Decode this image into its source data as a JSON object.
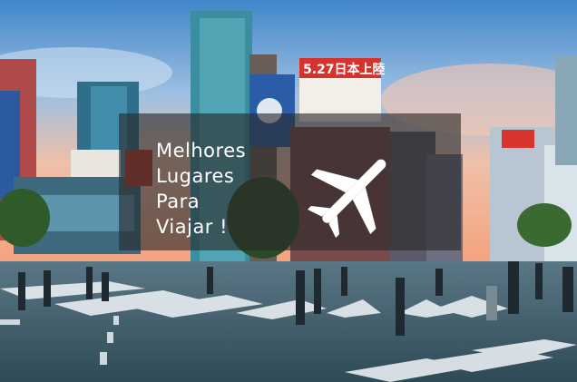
{
  "hero": {
    "headline_lines": [
      "Melhores",
      "Lugares",
      "Para",
      "Viajar !"
    ],
    "icon": "airplane-icon",
    "overlay_color": "#282828",
    "text_color": "#ffffff"
  },
  "scene": {
    "billboard_text": "5.27日本上陸"
  }
}
